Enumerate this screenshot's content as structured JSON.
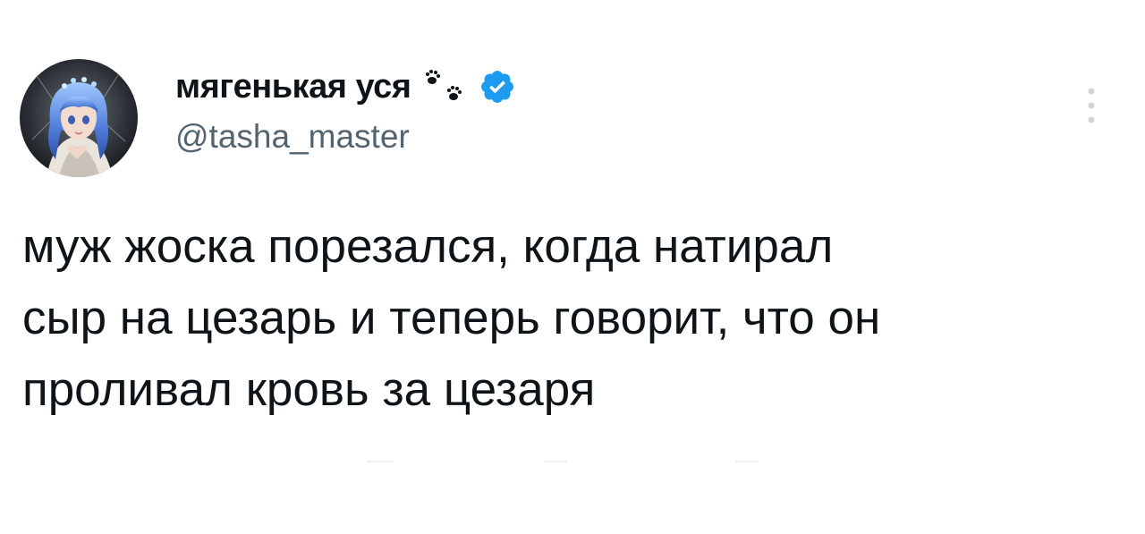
{
  "tweet": {
    "author": {
      "display_name": "мягенькая уся",
      "handle": "@tasha_master",
      "decoration_icon": "paw-prints-icon",
      "verified_icon": "verified-badge-icon",
      "avatar_icon": "anime-avatar"
    },
    "text": "муж жоска порезался, когда натирал\nсыр на цезарь и теперь говорит, что он\nпроливал кровь за цезаря",
    "menu_icon": "more-vertical-icon"
  },
  "colors": {
    "text": "#0f1419",
    "secondary_text": "#536471",
    "verified_blue": "#1d9bf0",
    "background": "#ffffff"
  }
}
